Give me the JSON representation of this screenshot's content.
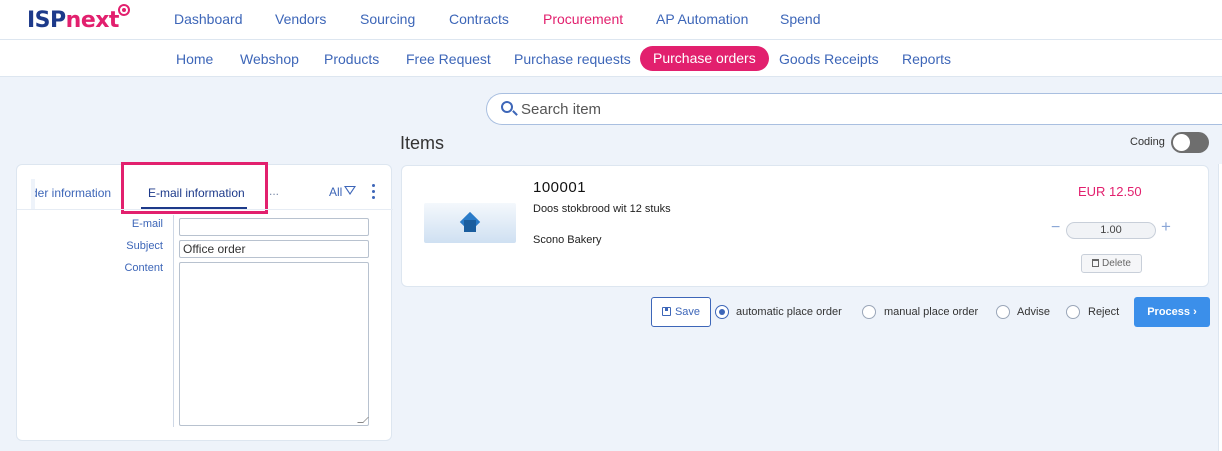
{
  "brand": {
    "name_part1": "ISP",
    "name_part2": "next"
  },
  "top_nav": [
    "Dashboard",
    "Vendors",
    "Sourcing",
    "Contracts",
    "Procurement",
    "AP Automation",
    "Spend"
  ],
  "top_nav_active": "Procurement",
  "sub_nav": [
    "Home",
    "Webshop",
    "Products",
    "Free Request",
    "Purchase requests",
    "Purchase orders",
    "Goods Receipts",
    "Reports"
  ],
  "sub_nav_active": "Purchase orders",
  "search": {
    "placeholder": "Search item"
  },
  "items_title": "Items",
  "coding": {
    "label": "Coding",
    "on": false
  },
  "left_panel": {
    "tab_order_info": "der information",
    "tab_email_info": "E-mail information",
    "tab_more": "...",
    "filter_label": "All",
    "fields": {
      "email_label": "E-mail",
      "email_value": "",
      "subject_label": "Subject",
      "subject_value": "Office order",
      "content_label": "Content",
      "content_value": ""
    }
  },
  "item": {
    "code": "100001",
    "description": "Doos stokbrood wit 12 stuks",
    "vendor": "Scono Bakery",
    "price": "EUR 12.50",
    "quantity": "1.00",
    "delete_label": "Delete"
  },
  "actions": {
    "save_label": "Save",
    "radio_options": [
      "automatic place order",
      "manual place order",
      "Advise",
      "Reject"
    ],
    "selected_option": "automatic place order",
    "process_label": "Process"
  },
  "colors": {
    "brand_blue": "#1d3a8a",
    "brand_pink": "#e2206e",
    "link_blue": "#3d66b8",
    "process_blue": "#3b8fea"
  }
}
